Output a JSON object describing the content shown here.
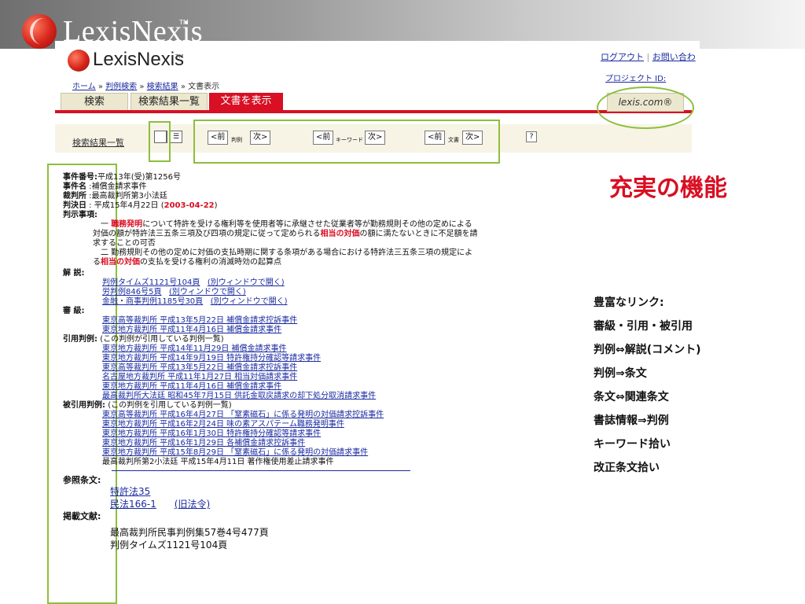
{
  "banner": {
    "logo_text": "LexisNexis",
    "tm": "TM"
  },
  "site": {
    "logo_text": "LexisNexis",
    "logo_tm": "TM",
    "top_links": [
      "ログアウト",
      "お問い合わ"
    ],
    "project_id": "プロジェクト ID:",
    "breadcrumb": [
      "ホーム",
      "判例検索",
      "検索結果",
      "文書表示"
    ],
    "tabs": [
      "検索",
      "検索結果一覧",
      "文書を表示"
    ],
    "lexis_button": "lexis.com®",
    "toolbar": {
      "result_list": "検索結果一覧",
      "prev": "<前",
      "next": "次>",
      "nav_groups": [
        "判例",
        "キーワード",
        "文書"
      ],
      "help": "?"
    }
  },
  "doc": {
    "case_no_label": "事件番号:",
    "case_no": "平成13年(受)第1256号",
    "case_name_label": "事件名",
    "case_name": "補償金請求事件",
    "court_label": "裁判所",
    "court": "最高裁判所第3小法廷",
    "date_label": "判決日",
    "date_text": "平成15年4月22日",
    "date_iso": "2003-04-22",
    "holding_label": "判示事項:",
    "holding_1a": "一",
    "holding_1_kw": "職務発明",
    "holding_1b": "について特許を受ける権利等を使用者等に承継させた従業者等が勤務規則その他の定めによる",
    "holding_1c": "対価の額が特許法三五条三項及び四項の規定に従って定められる",
    "holding_1_kw2": "相当の対価",
    "holding_1d": "の額に満たないときに不足額を請",
    "holding_1e": "求することの可否",
    "holding_2a": "二 勤務規則その他の定めに対価の支払時期に関する条項がある場合における特許法三五条三項の規定によ",
    "holding_2b": "る",
    "holding_2_kw": "相当の対価",
    "holding_2c": "の支払を受ける権利の消滅時効の起算点",
    "commentary_label": "解 説:",
    "commentary": [
      {
        "text": "判例タイムズ1121号104頁",
        "open": "(別ウィンドウで開く)"
      },
      {
        "text": "労判例846号5頁",
        "open": "(別ウィンドウで開く)"
      },
      {
        "text": "金融・商事判例1185号30頁",
        "open": "(別ウィンドウで開く)"
      }
    ],
    "instance_label": "審 級:",
    "instance": [
      "東京高等裁判所 平成13年5月22日 補償金請求控訴事件",
      "東京地方裁判所 平成11年4月16日 補償金請求事件"
    ],
    "cited_label": "引用判例:",
    "cited_note": "(この判例が引用している判例一覧)",
    "cited": [
      "東京地方裁判所 平成14年11月29日 補償金請求事件",
      "東京地方裁判所 平成14年9月19日 特許権持分確認等請求事件",
      "東京高等裁判所 平成13年5月22日 補償金請求控訴事件",
      "名古屋地方裁判所 平成11年1月27日 相当対価請求事件",
      "東京地方裁判所 平成11年4月16日 補償金請求事件",
      "最高裁判所大法廷 昭和45年7月15日 供託金取戻請求の却下処分取消請求事件"
    ],
    "citing_label": "被引用判例:",
    "citing_note": "(この判例を引用している判例一覧)",
    "citing": [
      "東京高等裁判所 平成16年4月27日 「窒素磁石」に係る発明の対価請求控訴事件",
      "東京地方裁判所 平成16年2月24日 味の素アスパテーム職務発明事件",
      "東京地方裁判所 平成16年1月30日 特許権持分確認等請求事件",
      "東京地方裁判所 平成16年1月29日 各補償金請求控訴事件",
      "東京地方裁判所 平成15年8月29日 「窒素磁石」に係る発明の対価請求事件",
      "最高裁判所第2小法廷 平成15年4月11日 著作権使用差止請求事件"
    ],
    "statutes_label": "参照条文:",
    "statutes": [
      {
        "text": "特許法35",
        "note": ""
      },
      {
        "text": "民法166-1",
        "note": "(旧法令)"
      }
    ],
    "pubs_label": "掲載文献:",
    "pubs": [
      "最高裁判所民事判例集57巻4号477頁",
      "判例タイムズ1121号104頁"
    ]
  },
  "slide": {
    "heading": "充実の機能",
    "features": [
      "豊富なリンク:",
      "審級・引用・被引用",
      "判例⇔解説(コメント)",
      "判例⇒条文",
      "条文⇔関連条文",
      "書誌情報⇒判例",
      "キーワード拾い",
      "改正条文拾い"
    ]
  },
  "colors": {
    "accent": "#d90f23",
    "highlight": "#8dbf3b",
    "link": "#1a2aa0"
  }
}
